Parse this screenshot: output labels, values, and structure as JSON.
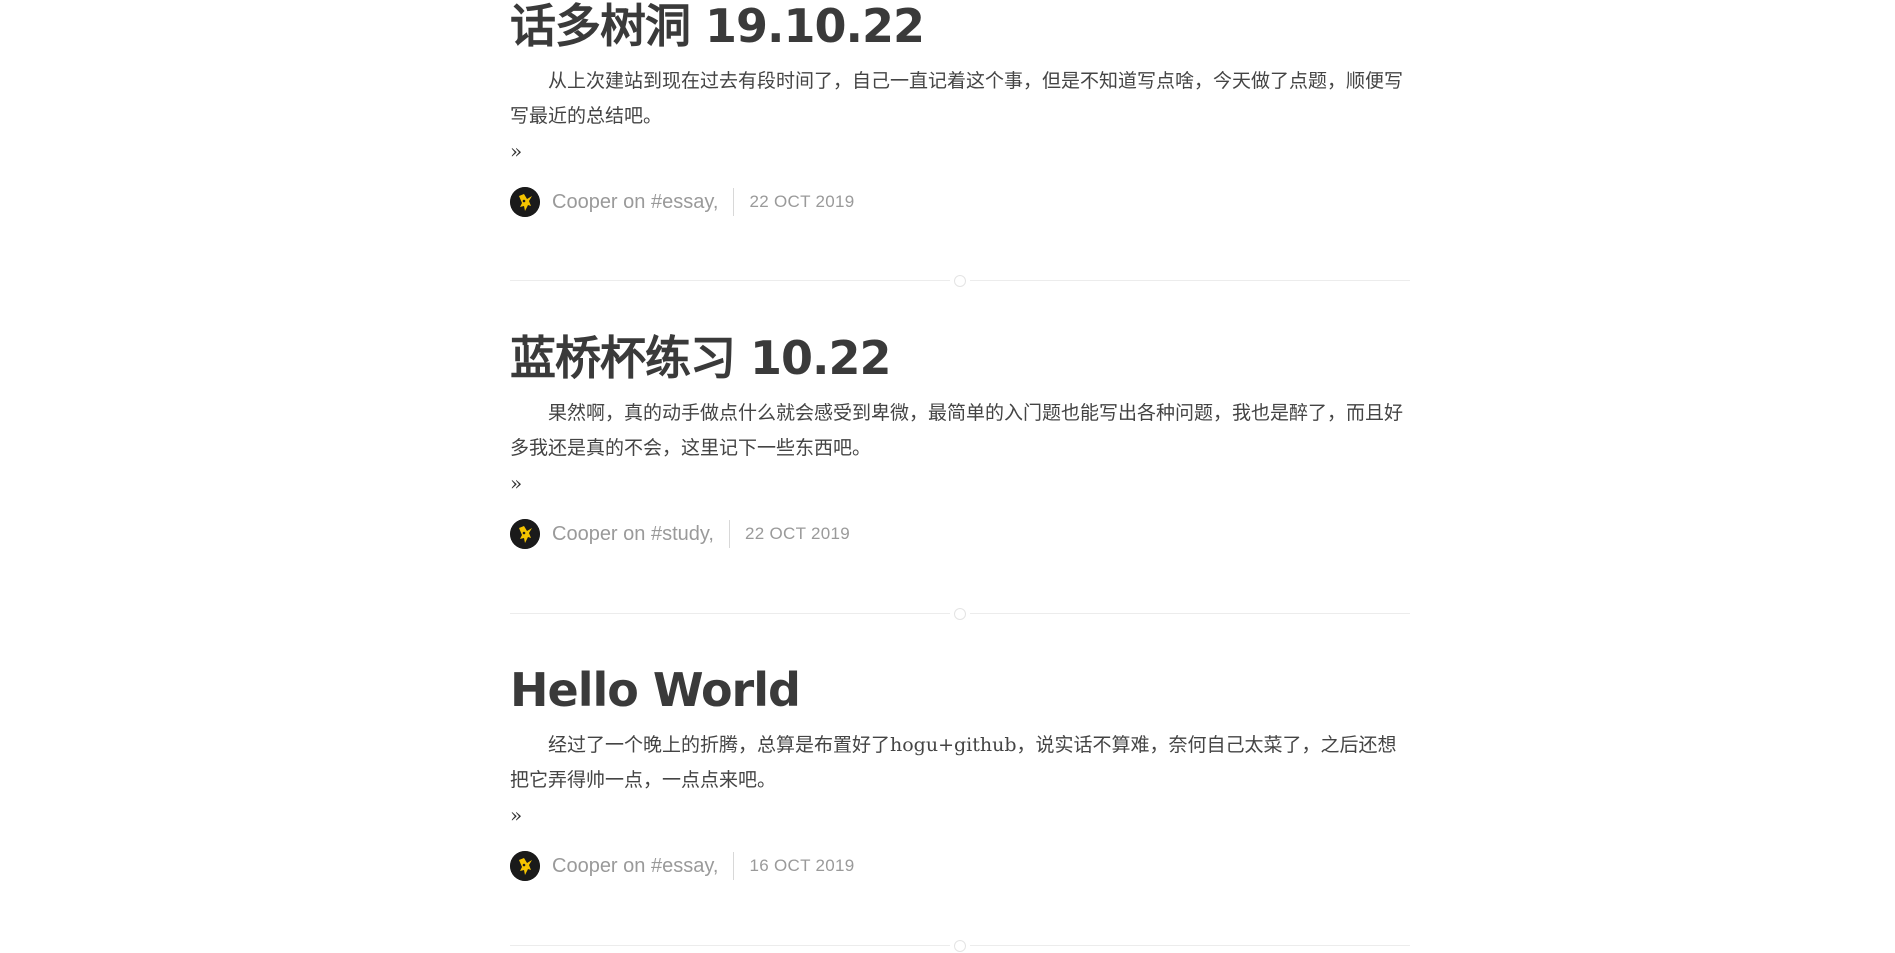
{
  "posts": [
    {
      "title": "话多树洞 19.10.22",
      "excerpt": "从上次建站到现在过去有段时间了，自己一直记着这个事，但是不知道写点啥，今天做了点题，顺便写写最近的总结吧。",
      "read_more": "»",
      "author": "Cooper",
      "on_label": "on",
      "tag": "#essay,",
      "date": "22 OCT 2019"
    },
    {
      "title": "蓝桥杯练习 10.22",
      "excerpt": "果然啊，真的动手做点什么就会感受到卑微，最简单的入门题也能写出各种问题，我也是醉了，而且好多我还是真的不会，这里记下一些东西吧。",
      "read_more": "»",
      "author": "Cooper",
      "on_label": "on",
      "tag": "#study,",
      "date": "22 OCT 2019"
    },
    {
      "title": "Hello World",
      "excerpt": "经过了一个晚上的折腾，总算是布置好了hogu+github，说实话不算难，奈何自己太菜了，之后还想把它弄得帅一点，一点点来吧。",
      "read_more": "»",
      "author": "Cooper",
      "on_label": "on",
      "tag": "#essay,",
      "date": "16 OCT 2019"
    }
  ],
  "avatar_icon": "pikachu-avatar-icon",
  "colors": {
    "title": "#3a3a3a",
    "meta": "#9a9a9a",
    "avatar_bg": "#1a1a1a",
    "avatar_accent": "#f5c400"
  }
}
